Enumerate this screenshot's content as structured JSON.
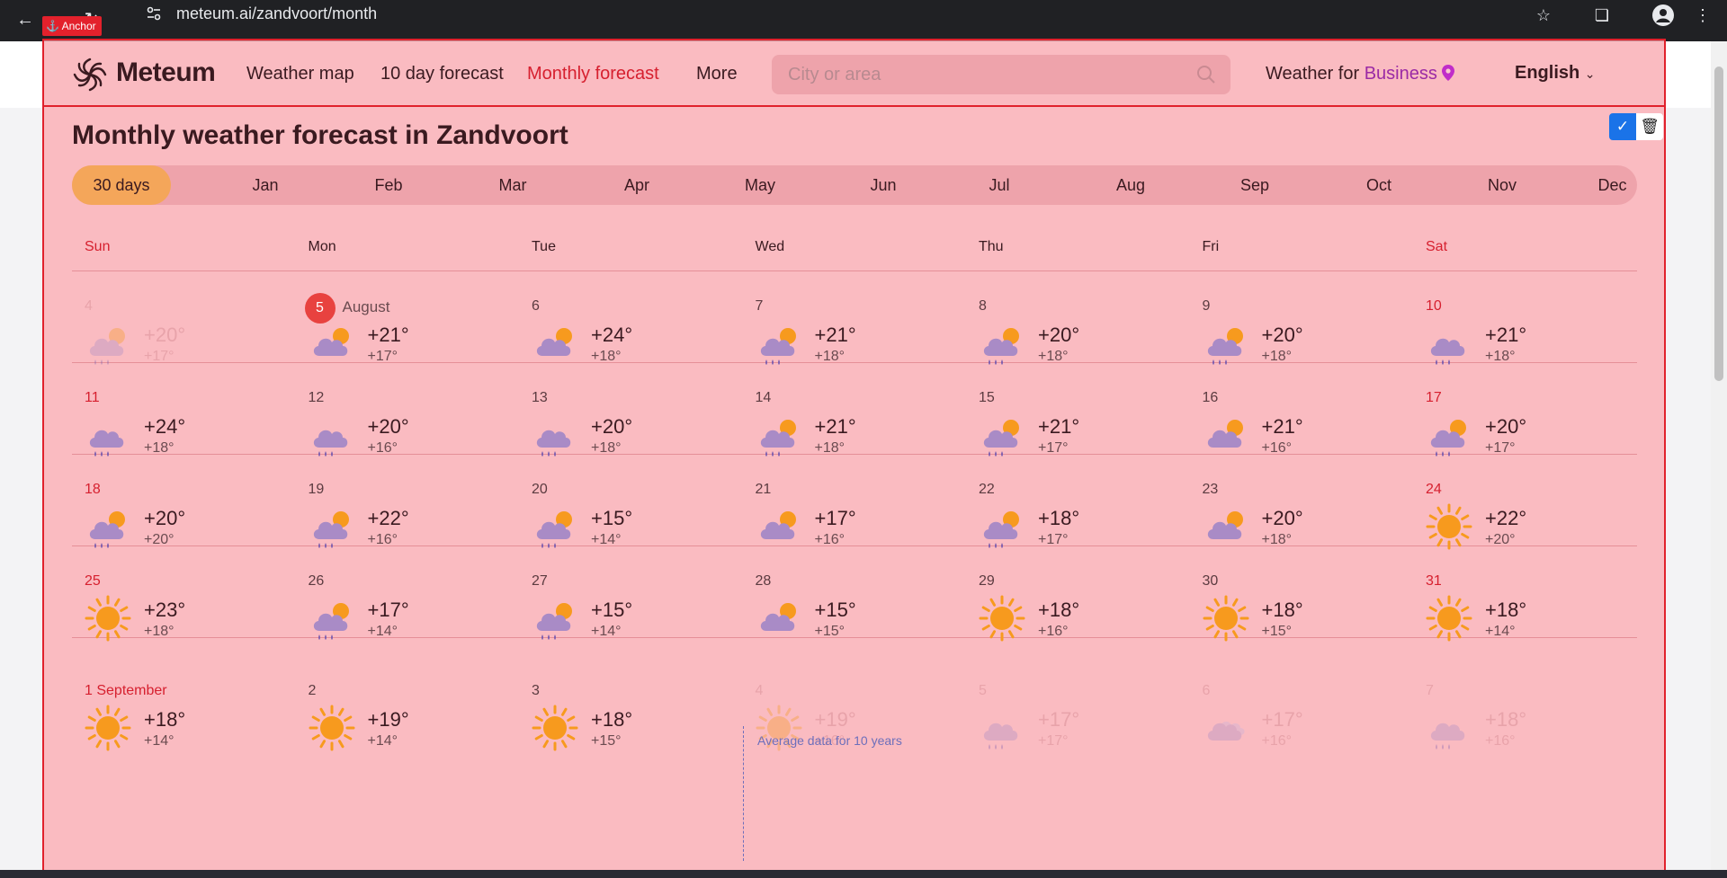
{
  "browser": {
    "url": "meteum.ai/zandvoort/month"
  },
  "anchor_label": "Anchor",
  "header": {
    "brand": "Meteum",
    "nav": [
      "Weather map",
      "10 day forecast",
      "Monthly forecast",
      "More"
    ],
    "search_placeholder": "City or area",
    "business_prefix": "Weather for ",
    "business_highlight": "Business",
    "language": "English"
  },
  "page_title": "Monthly weather forecast in Zandvoort",
  "months": [
    "30 days",
    "Jan",
    "Feb",
    "Mar",
    "Apr",
    "May",
    "Jun",
    "Jul",
    "Aug",
    "Sep",
    "Oct",
    "Nov",
    "Dec"
  ],
  "selected_month": "30 days",
  "weekdays": [
    "Sun",
    "Mon",
    "Tue",
    "Wed",
    "Thu",
    "Fri",
    "Sat"
  ],
  "avg_label": "Average data for 10 years",
  "calendar": [
    [
      {
        "d": "4",
        "hi": "+20°",
        "lo": "+17°",
        "icon": "cloud-sun-rain",
        "faded": true
      },
      {
        "d": "5",
        "month": "August",
        "hi": "+21°",
        "lo": "+17°",
        "icon": "cloud-sun",
        "today": true
      },
      {
        "d": "6",
        "hi": "+24°",
        "lo": "+18°",
        "icon": "cloud-sun"
      },
      {
        "d": "7",
        "hi": "+21°",
        "lo": "+18°",
        "icon": "cloud-sun-rain"
      },
      {
        "d": "8",
        "hi": "+20°",
        "lo": "+18°",
        "icon": "cloud-sun-rain"
      },
      {
        "d": "9",
        "hi": "+20°",
        "lo": "+18°",
        "icon": "cloud-sun-rain"
      },
      {
        "d": "10",
        "hi": "+21°",
        "lo": "+18°",
        "icon": "cloud-rain",
        "red": true
      }
    ],
    [
      {
        "d": "11",
        "hi": "+24°",
        "lo": "+18°",
        "icon": "cloud-rain",
        "red": true
      },
      {
        "d": "12",
        "hi": "+20°",
        "lo": "+16°",
        "icon": "cloud-rain"
      },
      {
        "d": "13",
        "hi": "+20°",
        "lo": "+18°",
        "icon": "cloud-rain"
      },
      {
        "d": "14",
        "hi": "+21°",
        "lo": "+18°",
        "icon": "cloud-sun-rain"
      },
      {
        "d": "15",
        "hi": "+21°",
        "lo": "+17°",
        "icon": "cloud-sun-rain"
      },
      {
        "d": "16",
        "hi": "+21°",
        "lo": "+16°",
        "icon": "cloud-sun"
      },
      {
        "d": "17",
        "hi": "+20°",
        "lo": "+17°",
        "icon": "cloud-sun-rain",
        "red": true
      }
    ],
    [
      {
        "d": "18",
        "hi": "+20°",
        "lo": "+20°",
        "icon": "cloud-sun-rain",
        "red": true
      },
      {
        "d": "19",
        "hi": "+22°",
        "lo": "+16°",
        "icon": "cloud-sun-rain"
      },
      {
        "d": "20",
        "hi": "+15°",
        "lo": "+14°",
        "icon": "cloud-sun-rain"
      },
      {
        "d": "21",
        "hi": "+17°",
        "lo": "+16°",
        "icon": "cloud-sun"
      },
      {
        "d": "22",
        "hi": "+18°",
        "lo": "+17°",
        "icon": "cloud-sun-rain"
      },
      {
        "d": "23",
        "hi": "+20°",
        "lo": "+18°",
        "icon": "cloud-sun"
      },
      {
        "d": "24",
        "hi": "+22°",
        "lo": "+20°",
        "icon": "sun",
        "red": true
      }
    ],
    [
      {
        "d": "25",
        "hi": "+23°",
        "lo": "+18°",
        "icon": "sun",
        "red": true
      },
      {
        "d": "26",
        "hi": "+17°",
        "lo": "+14°",
        "icon": "cloud-sun-rain"
      },
      {
        "d": "27",
        "hi": "+15°",
        "lo": "+14°",
        "icon": "cloud-sun-rain"
      },
      {
        "d": "28",
        "hi": "+15°",
        "lo": "+15°",
        "icon": "cloud-sun"
      },
      {
        "d": "29",
        "hi": "+18°",
        "lo": "+16°",
        "icon": "sun"
      },
      {
        "d": "30",
        "hi": "+18°",
        "lo": "+15°",
        "icon": "sun"
      },
      {
        "d": "31",
        "hi": "+18°",
        "lo": "+14°",
        "icon": "sun",
        "red": true
      }
    ],
    [
      {
        "d": "1 September",
        "hi": "+18°",
        "lo": "+14°",
        "icon": "sun",
        "red": true
      },
      {
        "d": "2",
        "hi": "+19°",
        "lo": "+14°",
        "icon": "sun"
      },
      {
        "d": "3",
        "hi": "+18°",
        "lo": "+15°",
        "icon": "sun"
      },
      {
        "d": "4",
        "hi": "+19°",
        "lo": "+16°",
        "icon": "sun",
        "faded": true
      },
      {
        "d": "5",
        "hi": "+17°",
        "lo": "+17°",
        "icon": "cloud-rain",
        "faded": true
      },
      {
        "d": "6",
        "hi": "+17°",
        "lo": "+16°",
        "icon": "clouds",
        "faded": true
      },
      {
        "d": "7",
        "hi": "+18°",
        "lo": "+16°",
        "icon": "cloud-rain",
        "faded": true
      }
    ]
  ],
  "colors": {
    "accent_red": "#d6202f",
    "month_selected": "#f4a65a",
    "overlay": "#f8a8af",
    "cloud": "#a98bc6",
    "sun": "#f79a1e"
  }
}
